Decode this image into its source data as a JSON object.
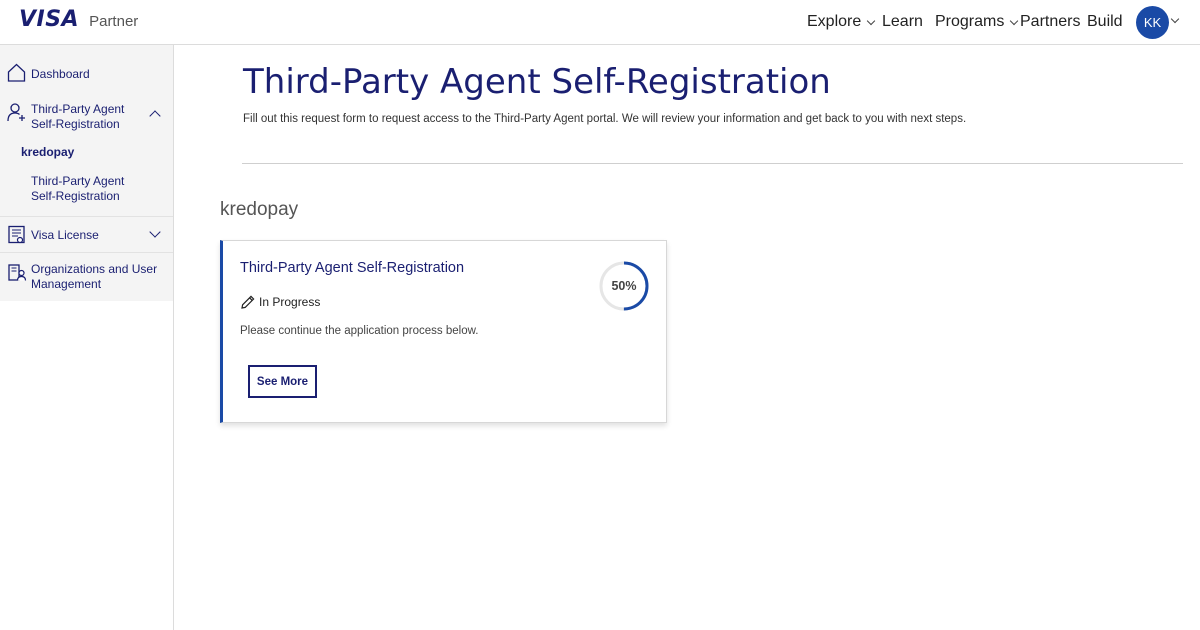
{
  "header": {
    "logo": "VISA",
    "logo_subtitle": "Partner",
    "nav": [
      {
        "label": "Explore",
        "has_dropdown": true
      },
      {
        "label": "Learn",
        "has_dropdown": false
      },
      {
        "label": "Programs",
        "has_dropdown": true
      },
      {
        "label": "Partners",
        "has_dropdown": false
      },
      {
        "label": "Build",
        "has_dropdown": false
      }
    ],
    "avatar_initials": "KK"
  },
  "sidebar": {
    "items": [
      {
        "label": "Dashboard",
        "icon": "home-icon"
      },
      {
        "label": "Third-Party Agent Self-Registration",
        "icon": "user-add-icon",
        "expanded": true
      },
      {
        "label": "kredopay"
      },
      {
        "label": "Third-Party Agent Self-Registration"
      },
      {
        "label": "Visa License",
        "icon": "license-icon",
        "expanded": false
      },
      {
        "label": "Organizations and User Management",
        "icon": "org-management-icon"
      }
    ]
  },
  "main": {
    "title": "Third-Party Agent Self-Registration",
    "description": "Fill out this request form to request access to the Third-Party Agent portal. We will review your information and get back to you with next steps.",
    "section_title": "kredopay",
    "card": {
      "title": "Third-Party Agent Self-Registration",
      "status": "In Progress",
      "message": "Please continue the application process below.",
      "button_label": "See More",
      "progress_percent": 50,
      "progress_label": "50%"
    }
  },
  "colors": {
    "brand_navy": "#1a1f71",
    "accent_blue": "#1a4aa6",
    "sidebar_bg": "#f4f4f4"
  }
}
